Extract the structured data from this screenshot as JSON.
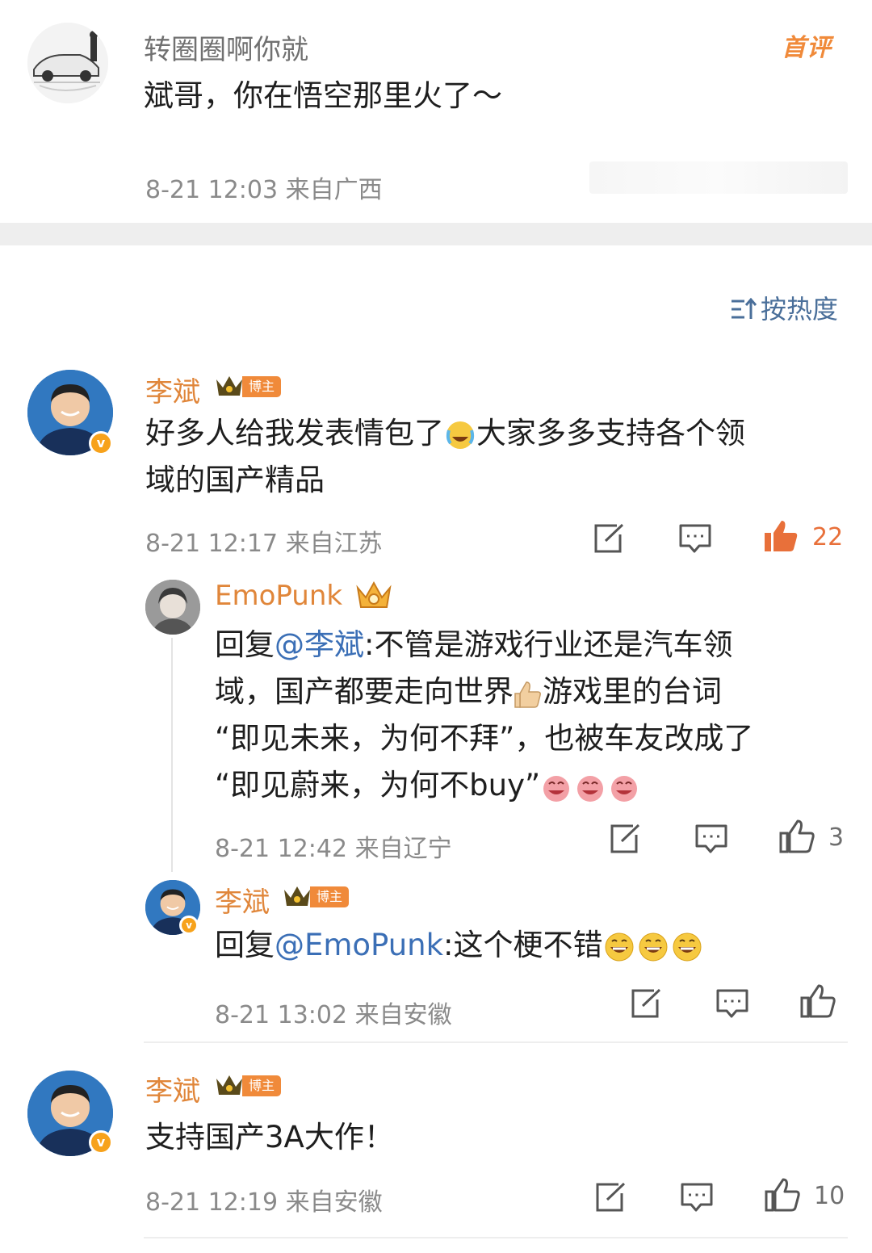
{
  "top_comment": {
    "username": "转圈圈啊你就",
    "text": "斌哥，你在悟空那里火了～",
    "meta": "8-21 12:03  来自广西",
    "badge": "首评",
    "avatar_icon": "car-avatar-icon"
  },
  "sort_label": "按热度",
  "sort_icon": "sort-icon",
  "comments": [
    {
      "username": "李斌",
      "tag": "博主",
      "text": "好多人给我发表情包了😂大家多多支持各个领域的国产精品",
      "text_before": "好多人给我发表情包了",
      "text_after": "大家多多支持各个领\n域的国产精品",
      "meta": "8-21 12:17  来自江苏",
      "likes": "22",
      "accent": "#e8703a"
    },
    {
      "username": "EmoPunk",
      "reply_prefix": "回复",
      "mention": "@李斌",
      "text_line1": ":不管是游戏行业还是汽车领",
      "text_line2a": "域，国产都要走向世界",
      "text_line2b": "游戏里的台词",
      "text_line3": "“即见未来，为何不拜”，也被车友改成了",
      "text_line4": "“即见蔚来，为何不buy”",
      "meta": "8-21 12:42  来自辽宁",
      "likes": "3"
    },
    {
      "username": "李斌",
      "tag": "博主",
      "reply_prefix": "回复",
      "mention": "@EmoPunk",
      "text": ":这个梗不错",
      "meta": "8-21 13:02  来自安徽",
      "likes": ""
    },
    {
      "username": "李斌",
      "tag": "博主",
      "text": "支持国产3A大作！",
      "meta": "8-21 12:19  来自安徽",
      "likes": "10"
    }
  ],
  "colors": {
    "username": "#e0863a",
    "mention": "#3b6fb6",
    "meta": "#8a8a8a",
    "like_active": "#e8703a"
  }
}
